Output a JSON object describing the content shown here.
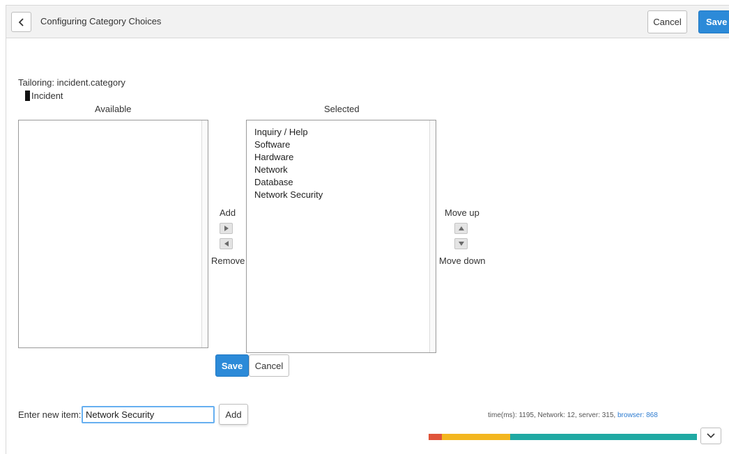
{
  "header": {
    "title": "Configuring Category Choices",
    "cancel_label": "Cancel",
    "save_label": "Save"
  },
  "tailoring": {
    "text": "Tailoring: incident.category",
    "table_label": "Incident"
  },
  "available": {
    "label": "Available",
    "items": []
  },
  "selected": {
    "label": "Selected",
    "items": [
      "Inquiry / Help",
      "Software",
      "Hardware",
      "Network",
      "Database",
      "Network Security"
    ]
  },
  "controls": {
    "add_label": "Add",
    "remove_label": "Remove",
    "move_up_label": "Move up",
    "move_down_label": "Move down"
  },
  "form": {
    "save_label": "Save",
    "cancel_label": "Cancel"
  },
  "new_item": {
    "label": "Enter new item:",
    "value": "Network Security",
    "add_label": "Add"
  },
  "timing": {
    "text": "time(ms): 1195, Network: 12, server: 315,",
    "browser": "browser: 868",
    "segments": [
      {
        "name": "network",
        "value": 12,
        "color": "#e0543a"
      },
      {
        "name": "server",
        "value": 315,
        "color": "#f3b61f"
      },
      {
        "name": "browser",
        "value": 868,
        "color": "#1fa9a3"
      }
    ]
  },
  "icons": {
    "back": "chevron-left-icon",
    "add": "triangle-right-icon",
    "remove": "triangle-left-icon",
    "up": "triangle-up-icon",
    "down": "triangle-down-icon",
    "expand": "chevron-down-icon"
  }
}
